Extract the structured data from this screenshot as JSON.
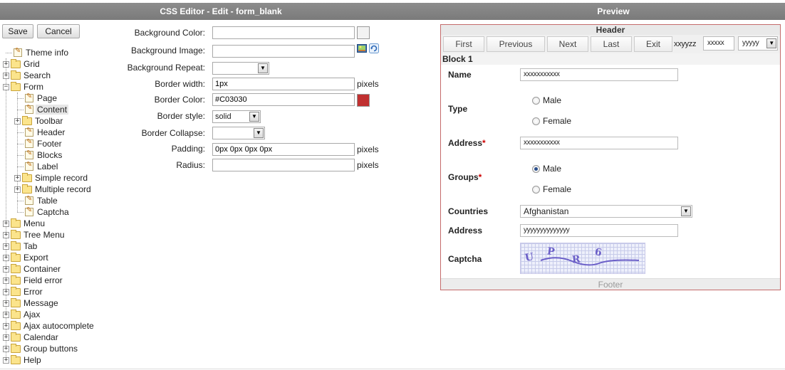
{
  "header": {
    "left_title": "CSS Editor - Edit - form_blank",
    "right_title": "Preview"
  },
  "toolbar": {
    "save_label": "Save",
    "cancel_label": "Cancel"
  },
  "tree": {
    "theme_info": "Theme info",
    "grid": "Grid",
    "search": "Search",
    "form": "Form",
    "page": "Page",
    "content": "Content",
    "toolbar": "Toolbar",
    "header": "Header",
    "footer": "Footer",
    "blocks": "Blocks",
    "label": "Label",
    "simple_record": "Simple record",
    "multiple_record": "Multiple record",
    "table": "Table",
    "captcha": "Captcha",
    "menu": "Menu",
    "tree_menu": "Tree Menu",
    "tab": "Tab",
    "export": "Export",
    "container": "Container",
    "field_error": "Field error",
    "error": "Error",
    "message": "Message",
    "ajax": "Ajax",
    "ajax_autocomplete": "Ajax autocomplete",
    "calendar": "Calendar",
    "group_buttons": "Group buttons",
    "help": "Help"
  },
  "form": {
    "bg_color": {
      "label": "Background Color:",
      "value": ""
    },
    "bg_image": {
      "label": "Background Image:",
      "value": ""
    },
    "bg_repeat": {
      "label": "Background Repeat:",
      "value": ""
    },
    "border_width": {
      "label": "Border width:",
      "value": "1px",
      "unit": "pixels"
    },
    "border_color": {
      "label": "Border Color:",
      "value": "#C03030",
      "swatch": "#c03030"
    },
    "border_style": {
      "label": "Border style:",
      "value": "solid"
    },
    "border_collapse": {
      "label": "Border Collapse:",
      "value": ""
    },
    "padding": {
      "label": "Padding:",
      "value": "0px 0px 0px 0px",
      "unit": "pixels"
    },
    "radius": {
      "label": "Radius:",
      "value": "",
      "unit": "pixels"
    }
  },
  "preview": {
    "header": "Header",
    "nav": {
      "first": "First",
      "previous": "Previous",
      "next": "Next",
      "last": "Last",
      "exit": "Exit",
      "text": "xxyyzz",
      "input": "xxxxx",
      "select": "yyyyy"
    },
    "block_title": "Block 1",
    "fields": {
      "name": {
        "label": "Name",
        "value": "xxxxxxxxxxx"
      },
      "type": {
        "label": "Type",
        "options": [
          "Male",
          "Female"
        ]
      },
      "address": {
        "label": "Address",
        "required": "*",
        "value": "xxxxxxxxxxx"
      },
      "groups": {
        "label": "Groups",
        "required": "*",
        "options": [
          "Male",
          "Female"
        ],
        "selected": "Male"
      },
      "countries": {
        "label": "Countries",
        "value": "Afghanistan"
      },
      "address2": {
        "label": "Address",
        "value": "yyyyyyyyyyyyyy"
      },
      "captcha": {
        "label": "Captcha",
        "chars": [
          "U",
          "P",
          "R",
          "6"
        ]
      }
    },
    "footer": "Footer"
  }
}
